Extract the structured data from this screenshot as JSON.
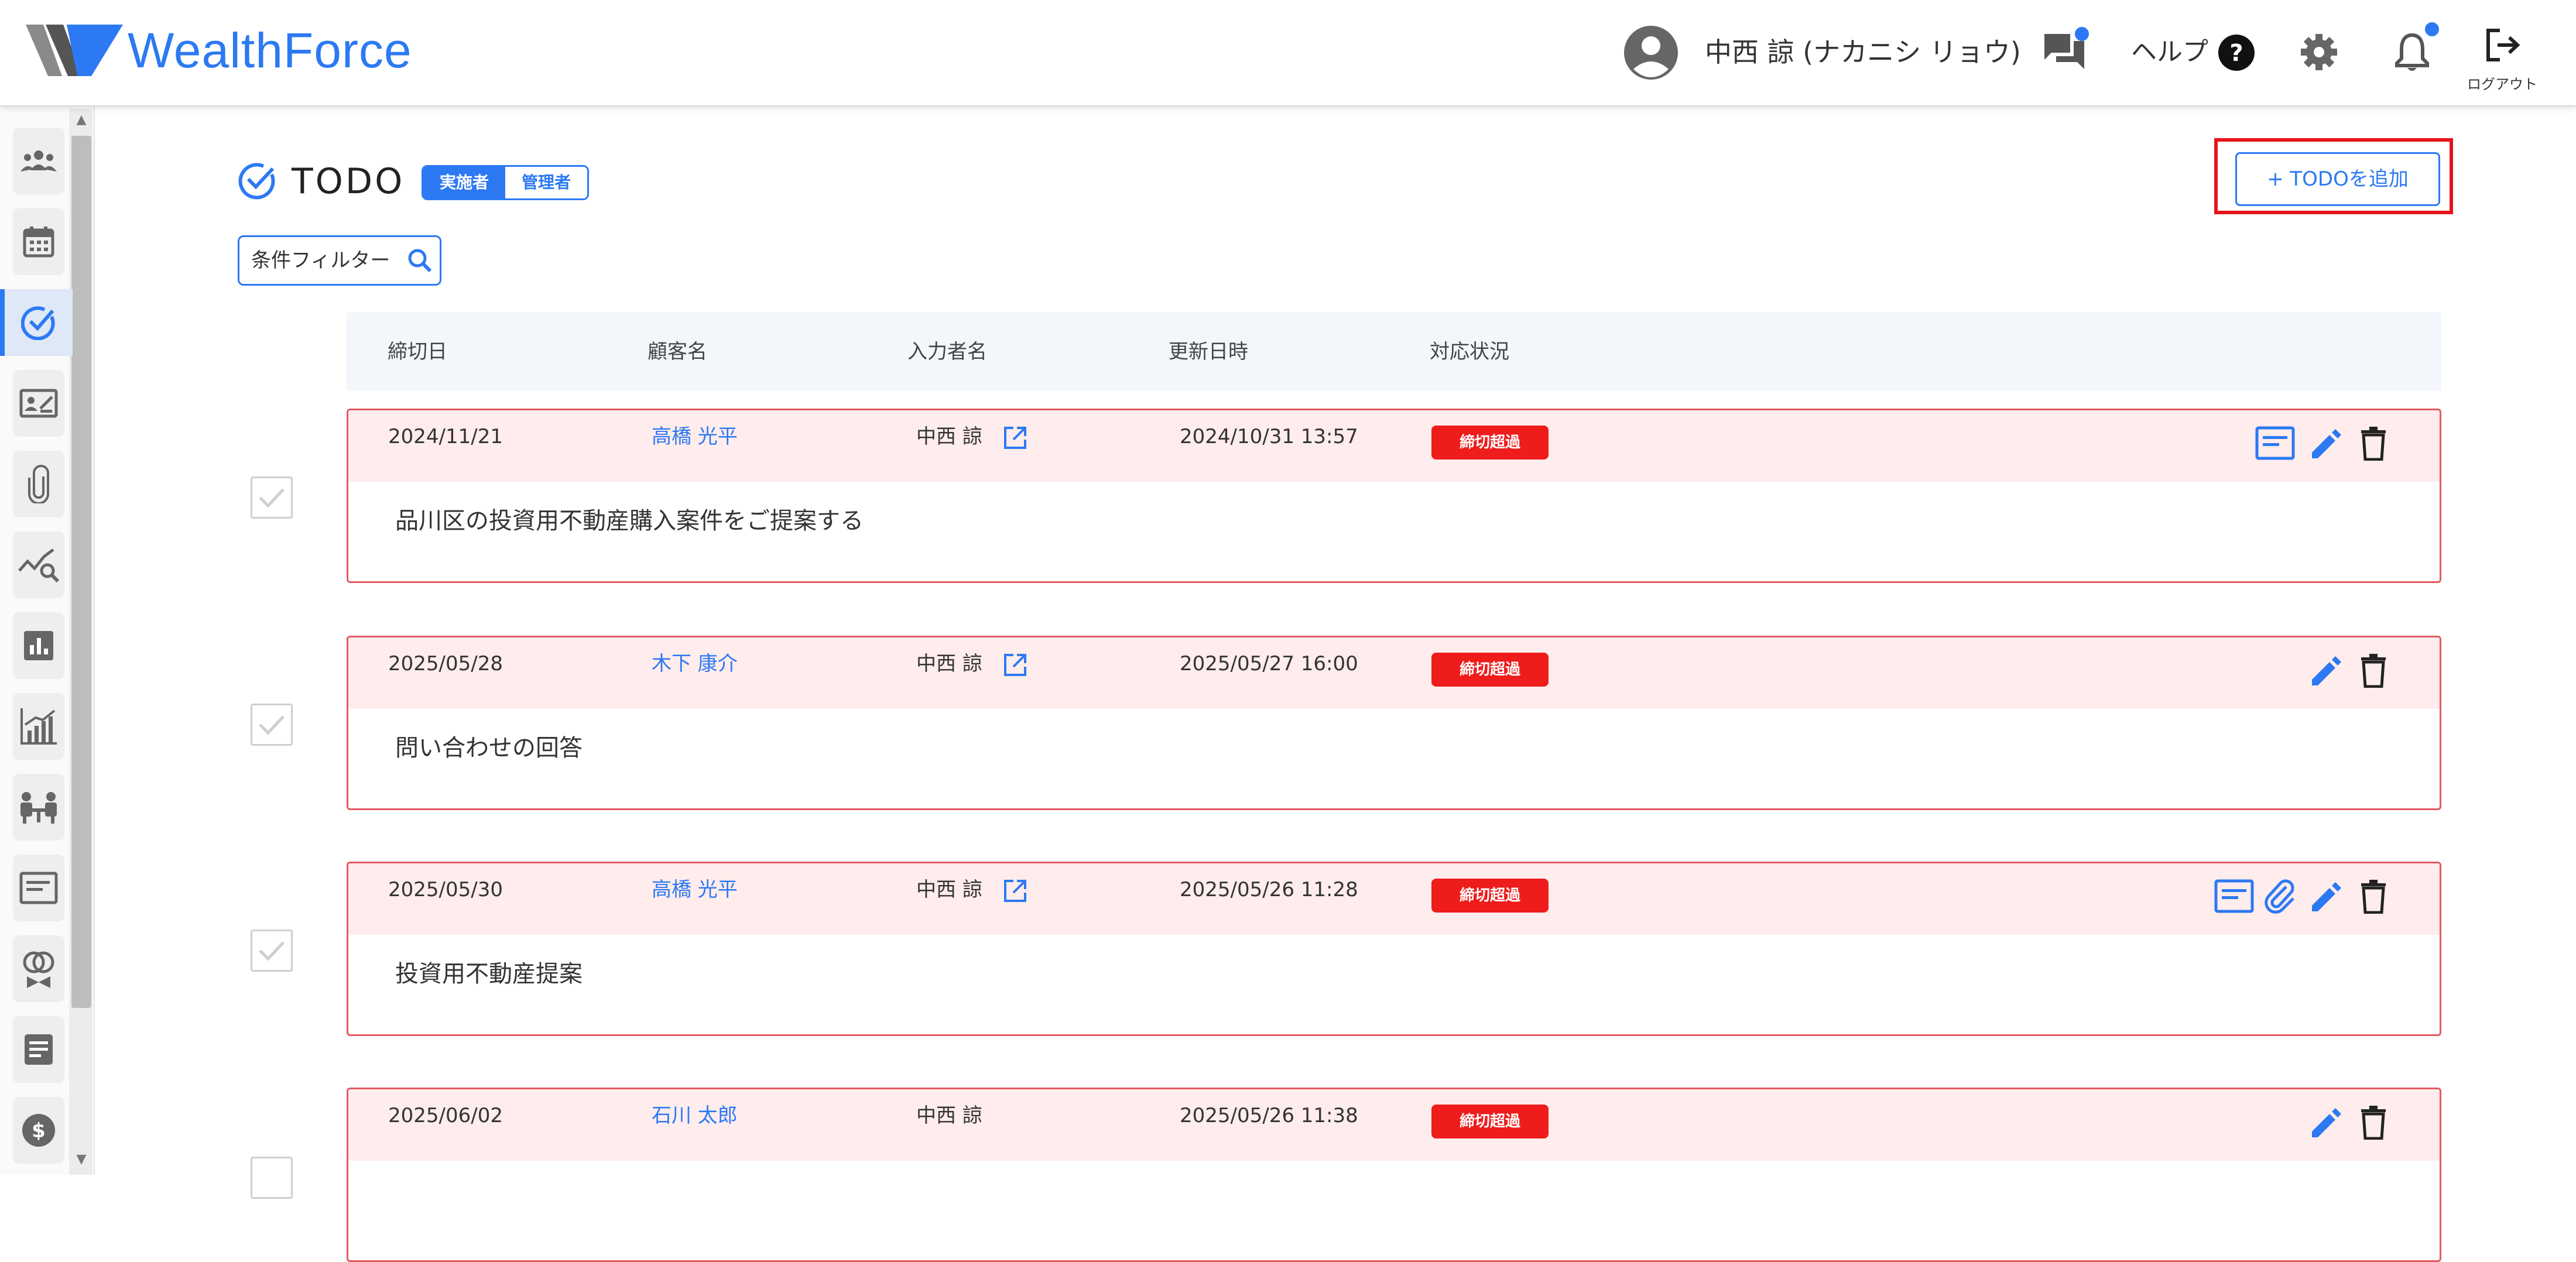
{
  "app": {
    "name": "WealthForce",
    "brand_color": "#2c79f3",
    "alert_color": "#ef1c1c"
  },
  "header": {
    "user_name": "中西 諒 (ナカニシ リョウ)",
    "help_label": "ヘルプ",
    "logout_label": "ログアウト",
    "icons": [
      "user-avatar-icon",
      "chat-icon",
      "help-icon",
      "gear-icon",
      "bell-icon",
      "logout-icon"
    ]
  },
  "sidebar": {
    "items": [
      {
        "icon": "people-group-icon"
      },
      {
        "icon": "calendar-icon"
      },
      {
        "icon": "todo-check-icon",
        "active": true
      },
      {
        "icon": "contact-card-icon"
      },
      {
        "icon": "paperclip-icon"
      },
      {
        "icon": "analysis-search-icon"
      },
      {
        "icon": "bar-report-icon"
      },
      {
        "icon": "growth-chart-icon"
      },
      {
        "icon": "meeting-icon"
      },
      {
        "icon": "document-panel-icon"
      },
      {
        "icon": "insurance-icon"
      },
      {
        "icon": "notes-icon"
      },
      {
        "icon": "dollar-icon"
      }
    ]
  },
  "page": {
    "title": "TODO",
    "role_toggle": {
      "executor": "実施者",
      "manager": "管理者",
      "selected": "実施者"
    },
    "add_button": "+ TODOを追加",
    "filter_label": "条件フィルター"
  },
  "table": {
    "columns": [
      "締切日",
      "顧客名",
      "入力者名",
      "更新日時",
      "対応状況"
    ],
    "rows": [
      {
        "due": "2024/11/21",
        "customer": "高橋 光平",
        "entered_by": "中西 諒",
        "has_link": true,
        "updated": "2024/10/31 13:57",
        "status": "締切超過",
        "body": "品川区の投資用不動産購入案件をご提案する",
        "actions": [
          "memo",
          "edit",
          "delete"
        ]
      },
      {
        "due": "2025/05/28",
        "customer": "木下 康介",
        "entered_by": "中西 諒",
        "has_link": true,
        "updated": "2025/05/27 16:00",
        "status": "締切超過",
        "body": "問い合わせの回答",
        "actions": [
          "edit",
          "delete"
        ]
      },
      {
        "due": "2025/05/30",
        "customer": "高橋 光平",
        "entered_by": "中西 諒",
        "has_link": true,
        "updated": "2025/05/26 11:28",
        "status": "締切超過",
        "body": "投資用不動産提案",
        "actions": [
          "memo",
          "attachment",
          "edit",
          "delete"
        ]
      },
      {
        "due": "2025/06/02",
        "customer": "石川 太郎",
        "entered_by": "中西 諒",
        "has_link": false,
        "updated": "2025/05/26 11:38",
        "status": "締切超過",
        "body": "",
        "actions": [
          "edit",
          "delete"
        ]
      }
    ]
  }
}
